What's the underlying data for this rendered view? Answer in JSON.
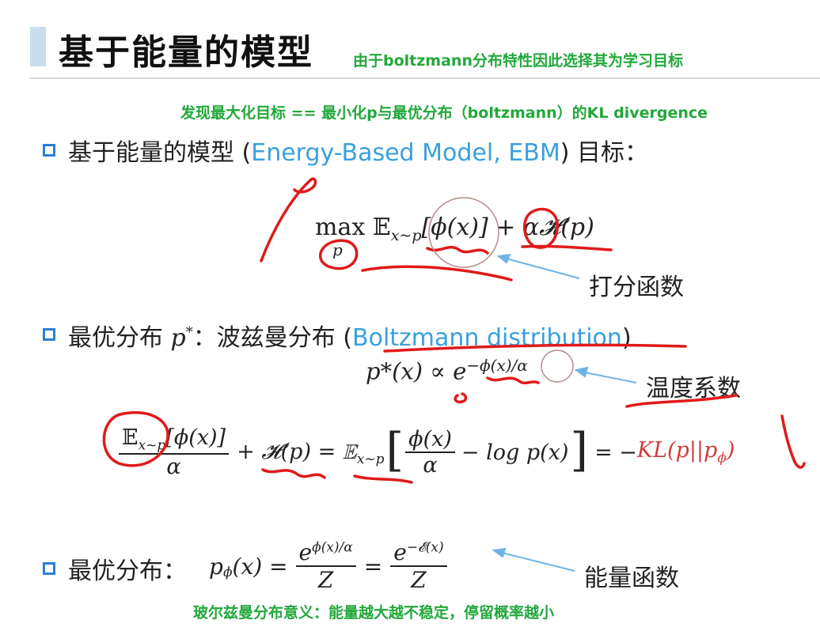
{
  "title": "基于能量的模型",
  "notes": {
    "boltzmann_reason": "由于boltzmann分布特性因此选择其为学习目标",
    "kl_note": "发现最大化目标 == 最小化p与最优分布（boltzmann）的KL divergence",
    "bottom_note": "玻尔兹曼分布意义：能量越大越不稳定，停留概率越小"
  },
  "bullets": {
    "ebm": {
      "prefix": "基于能量的模型 (",
      "term": "Energy-Based Model, EBM",
      "suffix": ") 目标："
    },
    "optimal": {
      "prefix": "最优分布 ",
      "sym": "p",
      "sup": "*",
      "mid": "：波兹曼分布 (",
      "term": "Boltzmann distribution",
      "suffix": ")"
    },
    "optimal2": {
      "prefix": "最优分布："
    }
  },
  "formulas": {
    "objective": {
      "max": "max",
      "sub": "p",
      "expect": "𝔼",
      "expect_sub": "x~p",
      "body": "[ϕ(x)] + α𝓗(p)"
    },
    "boltzmann": {
      "lhs": "p*(x) ∝ e",
      "exp": "−ϕ(x)/α"
    },
    "kl": {
      "num": "𝔼",
      "num_sub": "x~p",
      "num_rest": "[ϕ(x)]",
      "den": "α",
      "plus": "+ 𝓗(p) = 𝔼",
      "sub2": "x~p",
      "inner_num": "ϕ(x)",
      "inner_den": "α",
      "inner_rest": "− log p(x)",
      "eq": "= −",
      "kl_term": "KL(p||p",
      "kl_sub": "ϕ",
      "kl_end": ")"
    },
    "energy": {
      "lhs": "p",
      "lhs_sub": "ϕ",
      "lhs_rest": "(x) =",
      "f1_num": "e",
      "f1_exp": "ϕ(x)/α",
      "f1_den": "Z",
      "eq": "=",
      "f2_num": "e",
      "f2_exp": "−𝓔(x)",
      "f2_den": "Z"
    }
  },
  "annotations": {
    "scoring": "打分函数",
    "temperature": "温度系数",
    "energy_fn": "能量函数"
  },
  "colors": {
    "accent_blue": "#3aa0dd",
    "note_green": "#22a83a",
    "ink_red": "#e01a1a",
    "bullet_blue": "#2c7fd6"
  }
}
